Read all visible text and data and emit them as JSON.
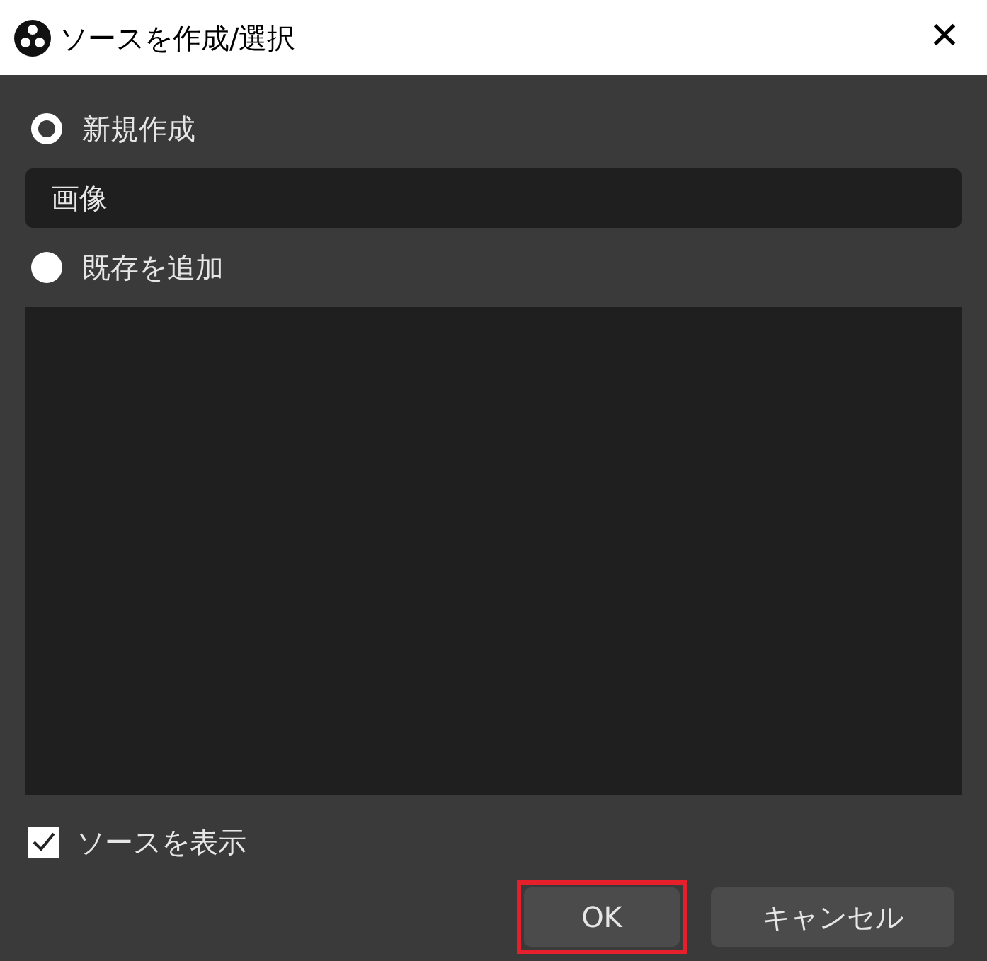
{
  "window": {
    "title": "ソースを作成/選択",
    "close": "✕"
  },
  "options": [
    {
      "label": "新規作成",
      "selected": true
    },
    {
      "label": "既存を追加",
      "selected": false
    }
  ],
  "name_field": {
    "value": "画像"
  },
  "show_source": {
    "label": "ソースを表示",
    "checked": true
  },
  "buttons": [
    {
      "label": "OK",
      "highlighted": true
    },
    {
      "label": "キャンセル",
      "highlighted": false
    }
  ]
}
